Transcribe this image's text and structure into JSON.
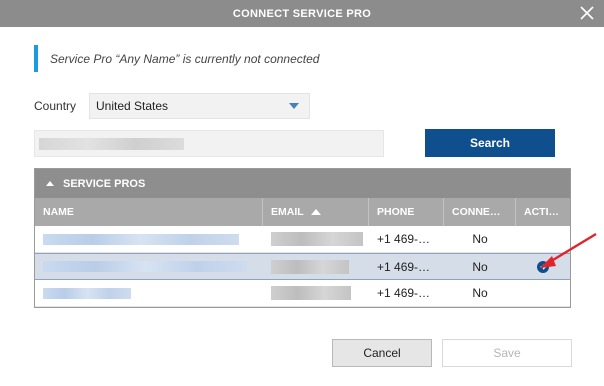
{
  "dialog": {
    "title": "CONNECT SERVICE PRO",
    "info_message": "Service Pro “Any Name” is currently not connected"
  },
  "country": {
    "label": "Country",
    "selected": "United States"
  },
  "search": {
    "button_label": "Search"
  },
  "grid": {
    "section_title": "SERVICE PROS",
    "columns": {
      "name": "NAME",
      "email": "EMAIL",
      "phone": "PHONE",
      "connected": "CONNE…",
      "actions": "ACTI…"
    },
    "rows": [
      {
        "phone": "+1 469-…",
        "connected": "No"
      },
      {
        "phone": "+1 469-…",
        "connected": "No"
      },
      {
        "phone": "+1 469-…",
        "connected": "No"
      }
    ]
  },
  "footer": {
    "cancel_label": "Cancel",
    "save_label": "Save"
  },
  "colors": {
    "accent": "#0f4f8e",
    "info_bar": "#1a9be0",
    "annotation_arrow": "#e0242b"
  }
}
